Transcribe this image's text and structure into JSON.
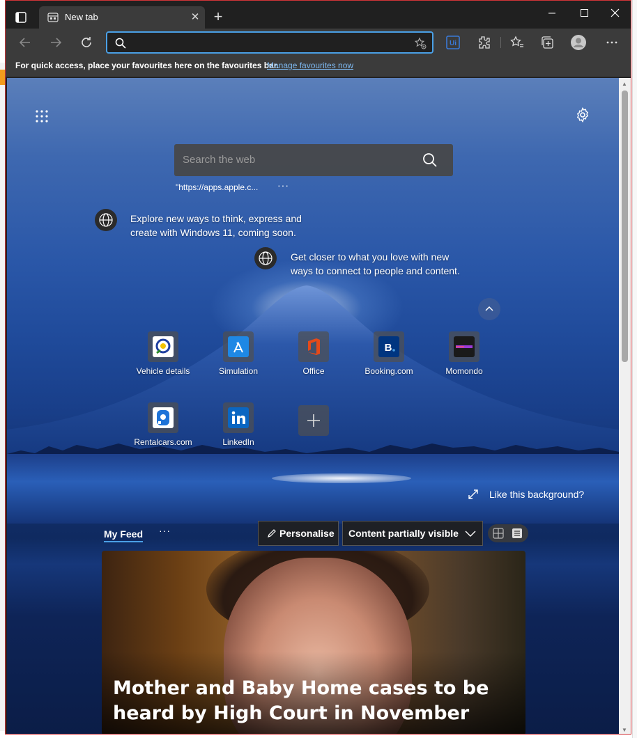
{
  "browser": {
    "tab": {
      "title": "New tab"
    },
    "address": {
      "value": "",
      "placeholder": ""
    },
    "favourites_bar": {
      "message": "For quick access, place your favourites here on the favourites bar.",
      "link": "Manage favourites now"
    }
  },
  "newtab": {
    "search": {
      "placeholder": "Search the web"
    },
    "recent_search": "\"https://apps.apple.c...",
    "recent_more": "···",
    "promos": [
      {
        "text": "Explore new ways to think, express and create with Windows 11, coming soon."
      },
      {
        "text": "Get closer to what you love with new ways to connect to people and content."
      }
    ],
    "quick_links": [
      {
        "label": "Vehicle details",
        "color": "#ffffff"
      },
      {
        "label": "Simulation",
        "color": "#1e88e5"
      },
      {
        "label": "Office",
        "color": "#d83b01"
      },
      {
        "label": "Booking.com",
        "color": "#003580"
      },
      {
        "label": "Momondo",
        "color": "#1a1a1a"
      },
      {
        "label": "Rentalcars.com",
        "color": "#ffffff"
      },
      {
        "label": "LinkedIn",
        "color": "#0a66c2"
      }
    ],
    "like_background": "Like this background?"
  },
  "feed": {
    "tab": "My Feed",
    "more": "···",
    "personalise": "Personalise",
    "visibility": "Content partially visible",
    "card": {
      "headline": "Mother and Baby Home cases to be heard by High Court in November"
    }
  },
  "colors": {
    "accent": "#4aa0e6",
    "window_border": "#d13438",
    "chrome": "#3b3b3b"
  }
}
